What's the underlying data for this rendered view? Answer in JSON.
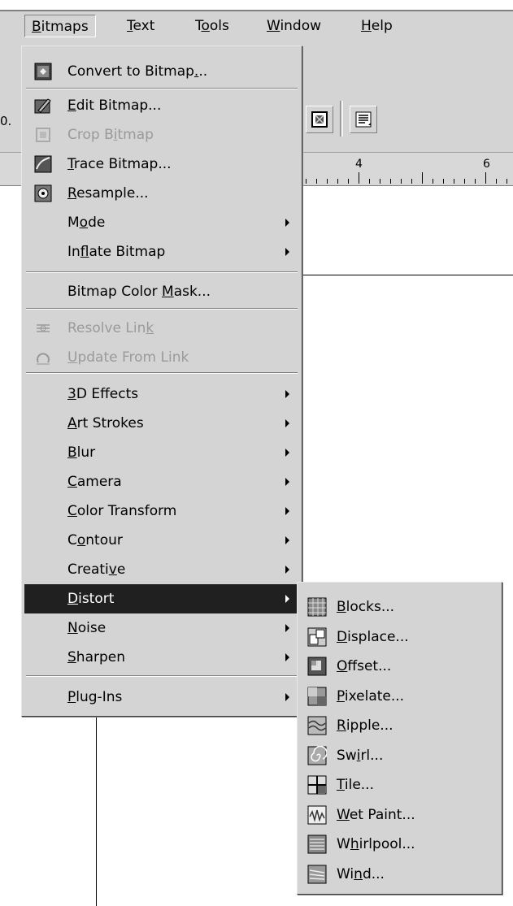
{
  "menubar": {
    "items": [
      {
        "pre": "",
        "key": "B",
        "post": "itmaps"
      },
      {
        "pre": "",
        "key": "T",
        "post": "ext"
      },
      {
        "pre": "T",
        "key": "o",
        "post": "ols"
      },
      {
        "pre": "",
        "key": "W",
        "post": "indow"
      },
      {
        "pre": "",
        "key": "H",
        "post": "elp"
      }
    ]
  },
  "toolbar": {
    "ghost_text": "0."
  },
  "ruler": {
    "labels": [
      "4",
      "6"
    ]
  },
  "bitmaps_menu": {
    "items": [
      {
        "pre": "Convert to Bitmap",
        "key": ".",
        "post": "..",
        "icon": "convert-to-bitmap-icon",
        "disabled": false,
        "submenu": false
      },
      {
        "pre": "",
        "key": "E",
        "post": "dit Bitmap...",
        "icon": "edit-bitmap-icon",
        "disabled": false,
        "submenu": false
      },
      {
        "pre": "Crop B",
        "key": "i",
        "post": "tmap",
        "icon": "crop-bitmap-icon",
        "disabled": true,
        "submenu": false
      },
      {
        "pre": "",
        "key": "T",
        "post": "race Bitmap...",
        "icon": "trace-bitmap-icon",
        "disabled": false,
        "submenu": false
      },
      {
        "pre": "",
        "key": "R",
        "post": "esample...",
        "icon": "resample-icon",
        "disabled": false,
        "submenu": false
      },
      {
        "pre": "M",
        "key": "o",
        "post": "de",
        "icon": "",
        "disabled": false,
        "submenu": true
      },
      {
        "pre": "In",
        "key": "f",
        "post": "late Bitmap",
        "icon": "",
        "disabled": false,
        "submenu": true
      },
      {
        "pre": "Bitmap Color ",
        "key": "M",
        "post": "ask...",
        "icon": "",
        "disabled": false,
        "submenu": false
      },
      {
        "pre": "Resolve Lin",
        "key": "k",
        "post": "",
        "icon": "resolve-link-icon",
        "disabled": true,
        "submenu": false
      },
      {
        "pre": "",
        "key": "U",
        "post": "pdate From Link",
        "icon": "update-from-link-icon",
        "disabled": true,
        "submenu": false
      },
      {
        "pre": "",
        "key": "3",
        "post": "D Effects",
        "icon": "",
        "disabled": false,
        "submenu": true
      },
      {
        "pre": "",
        "key": "A",
        "post": "rt Strokes",
        "icon": "",
        "disabled": false,
        "submenu": true
      },
      {
        "pre": "",
        "key": "B",
        "post": "lur",
        "icon": "",
        "disabled": false,
        "submenu": true
      },
      {
        "pre": "",
        "key": "C",
        "post": "amera",
        "icon": "",
        "disabled": false,
        "submenu": true
      },
      {
        "pre": "",
        "key": "C",
        "post": "olor Transform",
        "icon": "",
        "disabled": false,
        "submenu": true
      },
      {
        "pre": "C",
        "key": "o",
        "post": "ntour",
        "icon": "",
        "disabled": false,
        "submenu": true
      },
      {
        "pre": "Creati",
        "key": "v",
        "post": "e",
        "icon": "",
        "disabled": false,
        "submenu": true
      },
      {
        "pre": "",
        "key": "D",
        "post": "istort",
        "icon": "",
        "disabled": false,
        "submenu": true,
        "highlighted": true
      },
      {
        "pre": "",
        "key": "N",
        "post": "oise",
        "icon": "",
        "disabled": false,
        "submenu": true
      },
      {
        "pre": "",
        "key": "S",
        "post": "harpen",
        "icon": "",
        "disabled": false,
        "submenu": true
      },
      {
        "pre": "",
        "key": "P",
        "post": "lug-Ins",
        "icon": "",
        "disabled": false,
        "submenu": true
      }
    ]
  },
  "distort_menu": {
    "items": [
      {
        "pre": "",
        "key": "B",
        "post": "locks...",
        "icon": "blocks-icon"
      },
      {
        "pre": "",
        "key": "D",
        "post": "isplace...",
        "icon": "displace-icon"
      },
      {
        "pre": "",
        "key": "O",
        "post": "ffset...",
        "icon": "offset-icon"
      },
      {
        "pre": "",
        "key": "P",
        "post": "ixelate...",
        "icon": "pixelate-icon"
      },
      {
        "pre": "",
        "key": "R",
        "post": "ipple...",
        "icon": "ripple-icon"
      },
      {
        "pre": "Sw",
        "key": "i",
        "post": "rl...",
        "icon": "swirl-icon"
      },
      {
        "pre": "",
        "key": "T",
        "post": "ile...",
        "icon": "tile-icon"
      },
      {
        "pre": "",
        "key": "W",
        "post": "et Paint...",
        "icon": "wet-paint-icon"
      },
      {
        "pre": "W",
        "key": "h",
        "post": "irlpool...",
        "icon": "whirlpool-icon"
      },
      {
        "pre": "Wi",
        "key": "n",
        "post": "d...",
        "icon": "wind-icon"
      }
    ]
  }
}
